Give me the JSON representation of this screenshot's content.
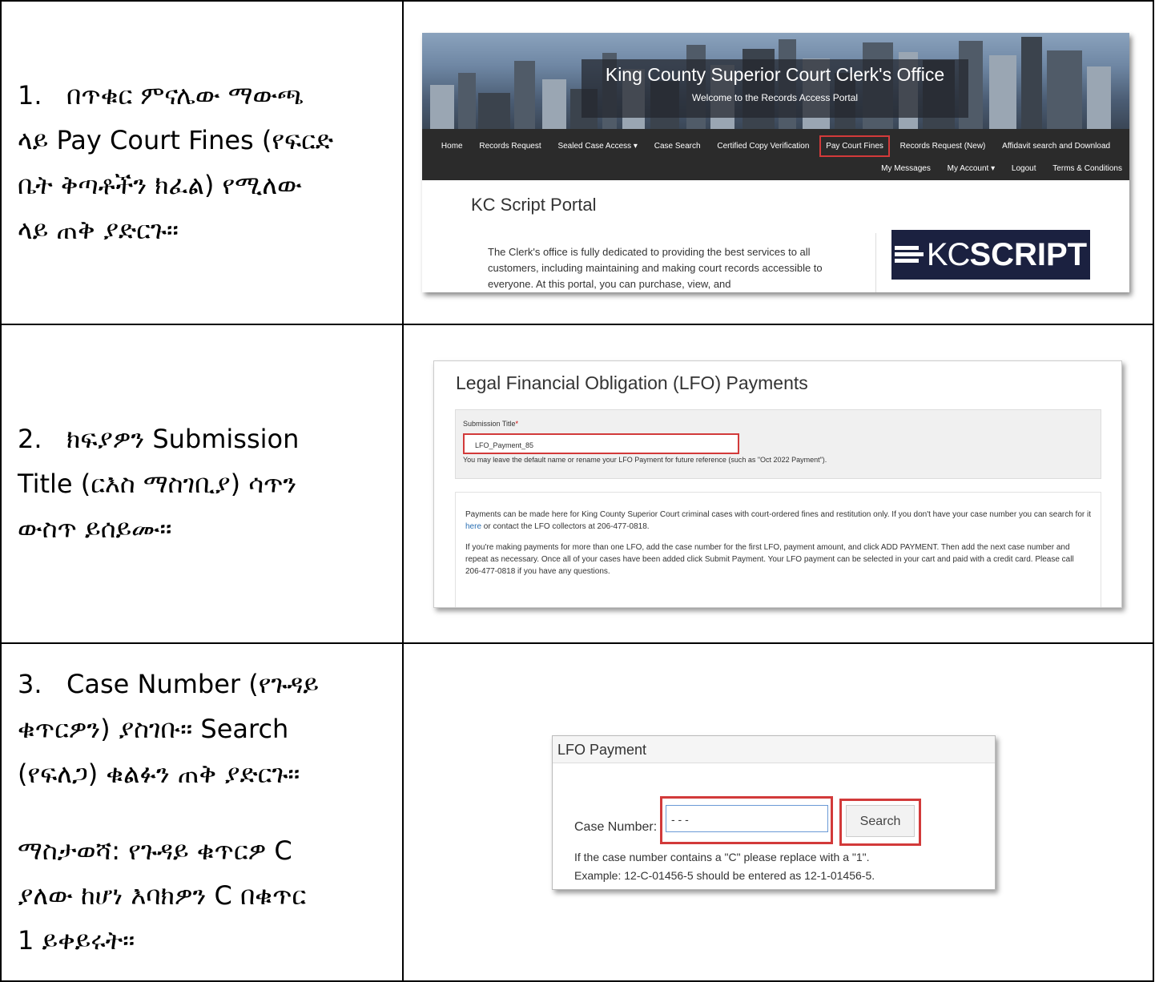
{
  "rows": [
    {
      "lines": [
        "1.   በጥቁር ምናሌው ማውጫ",
        "ላይ Pay Court Fines (የፍርድ",
        "ቤት ቅጣቶችን ክፈል) የሚለው",
        "ላይ ጠቅ ያድርጉ።"
      ]
    },
    {
      "lines": [
        "2.   ክፍያዎን Submission",
        "Title (ርእስ ማስገቢያ) ሳጥን",
        "ውስጥ ይሰይሙ።"
      ]
    },
    {
      "lines": [
        "3.   Case Number (የጉዳይ",
        "ቁጥርዎን) ያስገቡ። Search",
        "(የፍለጋ) ቁልፉን ጠቅ ያድርጉ።"
      ],
      "note_lines": [
        "ማስታወሻ: የጉዳይ ቁጥርዎ C",
        "ያለው ከሆነ እባክዎን C በቁጥር",
        "1 ይቀይሩት።"
      ]
    }
  ],
  "shot1": {
    "title": "King County Superior Court Clerk's Office",
    "subtitle": "Welcome to the Records Access Portal",
    "nav_row1": [
      "Home",
      "Records Request",
      "Sealed Case Access ▾",
      "Case Search",
      "Certified Copy Verification",
      "Pay Court Fines",
      "Records Request (New)",
      "Affidavit search and Download"
    ],
    "nav_row2": [
      "My Messages",
      "My Account ▾",
      "Logout",
      "Terms & Conditions"
    ],
    "portal_title": "KC Script Portal",
    "portal_text": "The Clerk's office is fully dedicated to providing the best services to all customers, including maintaining and making court records accessible to everyone. At this portal, you can purchase, view, and",
    "logo_light": "KC",
    "logo_bold": "SCRIPT",
    "highlight_color": "#d23a3a"
  },
  "shot2": {
    "title": "Legal Financial Obligation (LFO) Payments",
    "field_label": "Submission Title",
    "required_mark": "*",
    "field_value": "LFO_Payment_85",
    "field_hint": "You may leave the default name or rename your LFO Payment for future reference (such as \"Oct 2022 Payment\").",
    "para1_a": "Payments can be made here for King County Superior Court criminal cases with court-ordered fines and restitution only. If you don't have your case number you can search for it ",
    "para1_link": "here",
    "para1_b": " or contact the LFO collectors at 206-477-0818.",
    "para2": "If you're making payments for more than one LFO, add the case number for the first LFO, payment amount, and click ADD PAYMENT. Then add the next case number and repeat as necessary. Once all of your cases have been added click Submit Payment. Your LFO payment can be selected in your cart and paid with a credit card. Please call 206-477-0818 if you have any questions."
  },
  "shot3": {
    "title": "LFO Payment",
    "case_label": "Case Number:",
    "case_value": "- -   -",
    "search_label": "Search",
    "hint1": "If the case number contains a \"C\" please replace with a \"1\".",
    "hint2": "Example: 12-C-01456-5 should be entered as 12-1-01456-5."
  }
}
